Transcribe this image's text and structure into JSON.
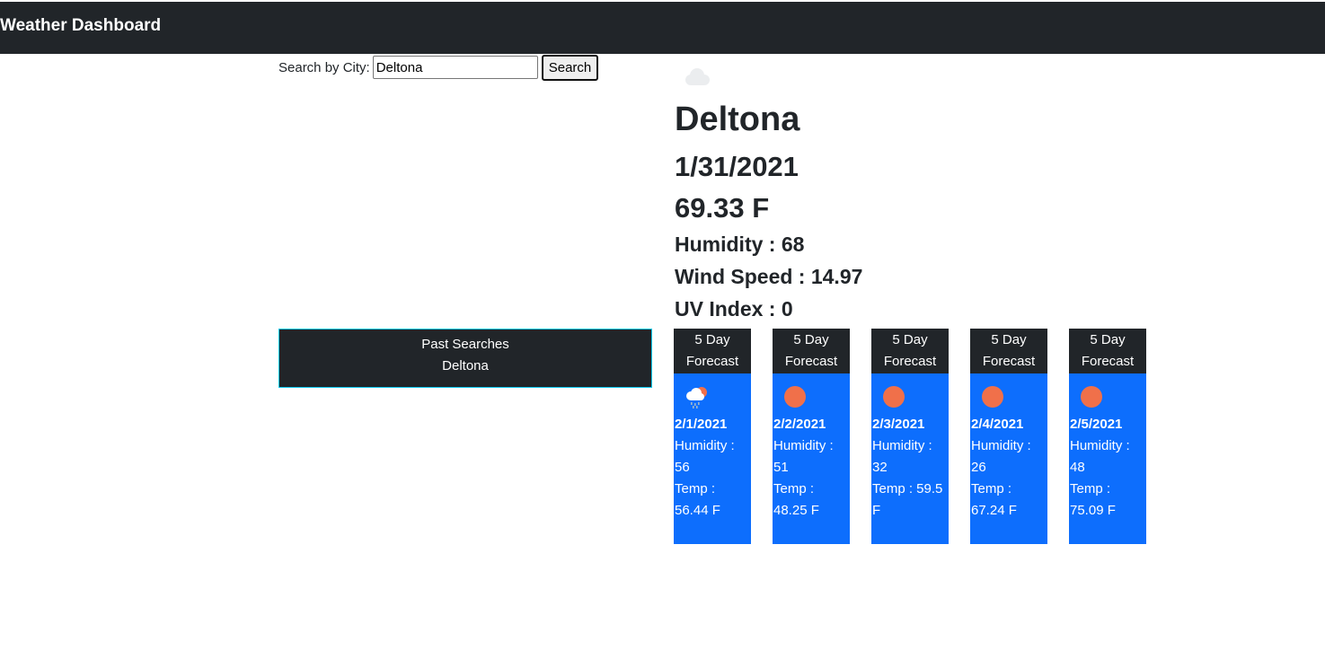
{
  "navbar": {
    "title": "Weather Dashboard"
  },
  "search": {
    "label": "Search by City:",
    "value": "Deltona",
    "button_label": "Search"
  },
  "current": {
    "icon": "cloud-icon",
    "city": "Deltona",
    "date": "1/31/2021",
    "temp": "69.33 F",
    "humidity": "Humidity : 68",
    "wind": "Wind Speed : 14.97",
    "uv": "UV Index : 0"
  },
  "past_searches": {
    "title": "Past Searches",
    "items": [
      "Deltona"
    ]
  },
  "forecast": {
    "header_line1": "5 Day",
    "header_line2": "Forecast",
    "days": [
      {
        "date": "2/1/2021",
        "icon": "rain-sun-icon",
        "humidity_line1": "Humidity :",
        "humidity_line2": "56",
        "temp_line1": "Temp :",
        "temp_line2": "56.44 F"
      },
      {
        "date": "2/2/2021",
        "icon": "sun-icon",
        "humidity_line1": "Humidity :",
        "humidity_line2": "51",
        "temp_line1": "Temp :",
        "temp_line2": "48.25 F"
      },
      {
        "date": "2/3/2021",
        "icon": "sun-icon",
        "humidity_line1": "Humidity :",
        "humidity_line2": "32",
        "temp_line1": "Temp : 59.5",
        "temp_line2": "F"
      },
      {
        "date": "2/4/2021",
        "icon": "sun-icon",
        "humidity_line1": "Humidity :",
        "humidity_line2": "26",
        "temp_line1": "Temp :",
        "temp_line2": "67.24 F"
      },
      {
        "date": "2/5/2021",
        "icon": "sun-icon",
        "humidity_line1": "Humidity :",
        "humidity_line2": "48",
        "temp_line1": "Temp :",
        "temp_line2": "75.09 F"
      }
    ]
  },
  "colors": {
    "navbar_bg": "#212529",
    "card_bg": "#0d6efd",
    "sun": "#f0704a",
    "past_border": "#0dcaf0"
  }
}
